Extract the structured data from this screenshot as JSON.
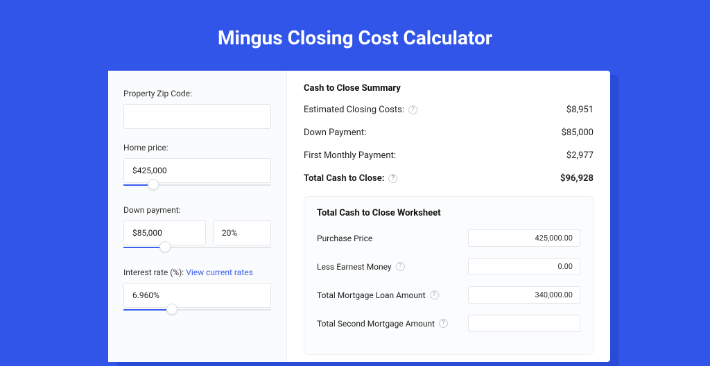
{
  "title": "Mingus Closing Cost Calculator",
  "left": {
    "zip_label": "Property Zip Code:",
    "zip_value": "",
    "home_price_label": "Home price:",
    "home_price_value": "$425,000",
    "home_price_slider_pct": 20,
    "down_payment_label": "Down payment:",
    "down_payment_value": "$85,000",
    "down_payment_pct": "20%",
    "down_payment_slider_pct": 28,
    "interest_label_prefix": "Interest rate (%): ",
    "interest_link": "View current rates",
    "interest_value": "6.960%",
    "interest_slider_pct": 33
  },
  "summary": {
    "title": "Cash to Close Summary",
    "est_costs_label": "Estimated Closing Costs:",
    "est_costs_value": "$8,951",
    "down_payment_label": "Down Payment:",
    "down_payment_value": "$85,000",
    "first_monthly_label": "First Monthly Payment:",
    "first_monthly_value": "$2,977",
    "total_label": "Total Cash to Close:",
    "total_value": "$96,928"
  },
  "worksheet": {
    "title": "Total Cash to Close Worksheet",
    "purchase_price_label": "Purchase Price",
    "purchase_price_value": "425,000.00",
    "earnest_label": "Less Earnest Money",
    "earnest_value": "0.00",
    "loan_amount_label": "Total Mortgage Loan Amount",
    "loan_amount_value": "340,000.00",
    "second_mortgage_label": "Total Second Mortgage Amount"
  }
}
